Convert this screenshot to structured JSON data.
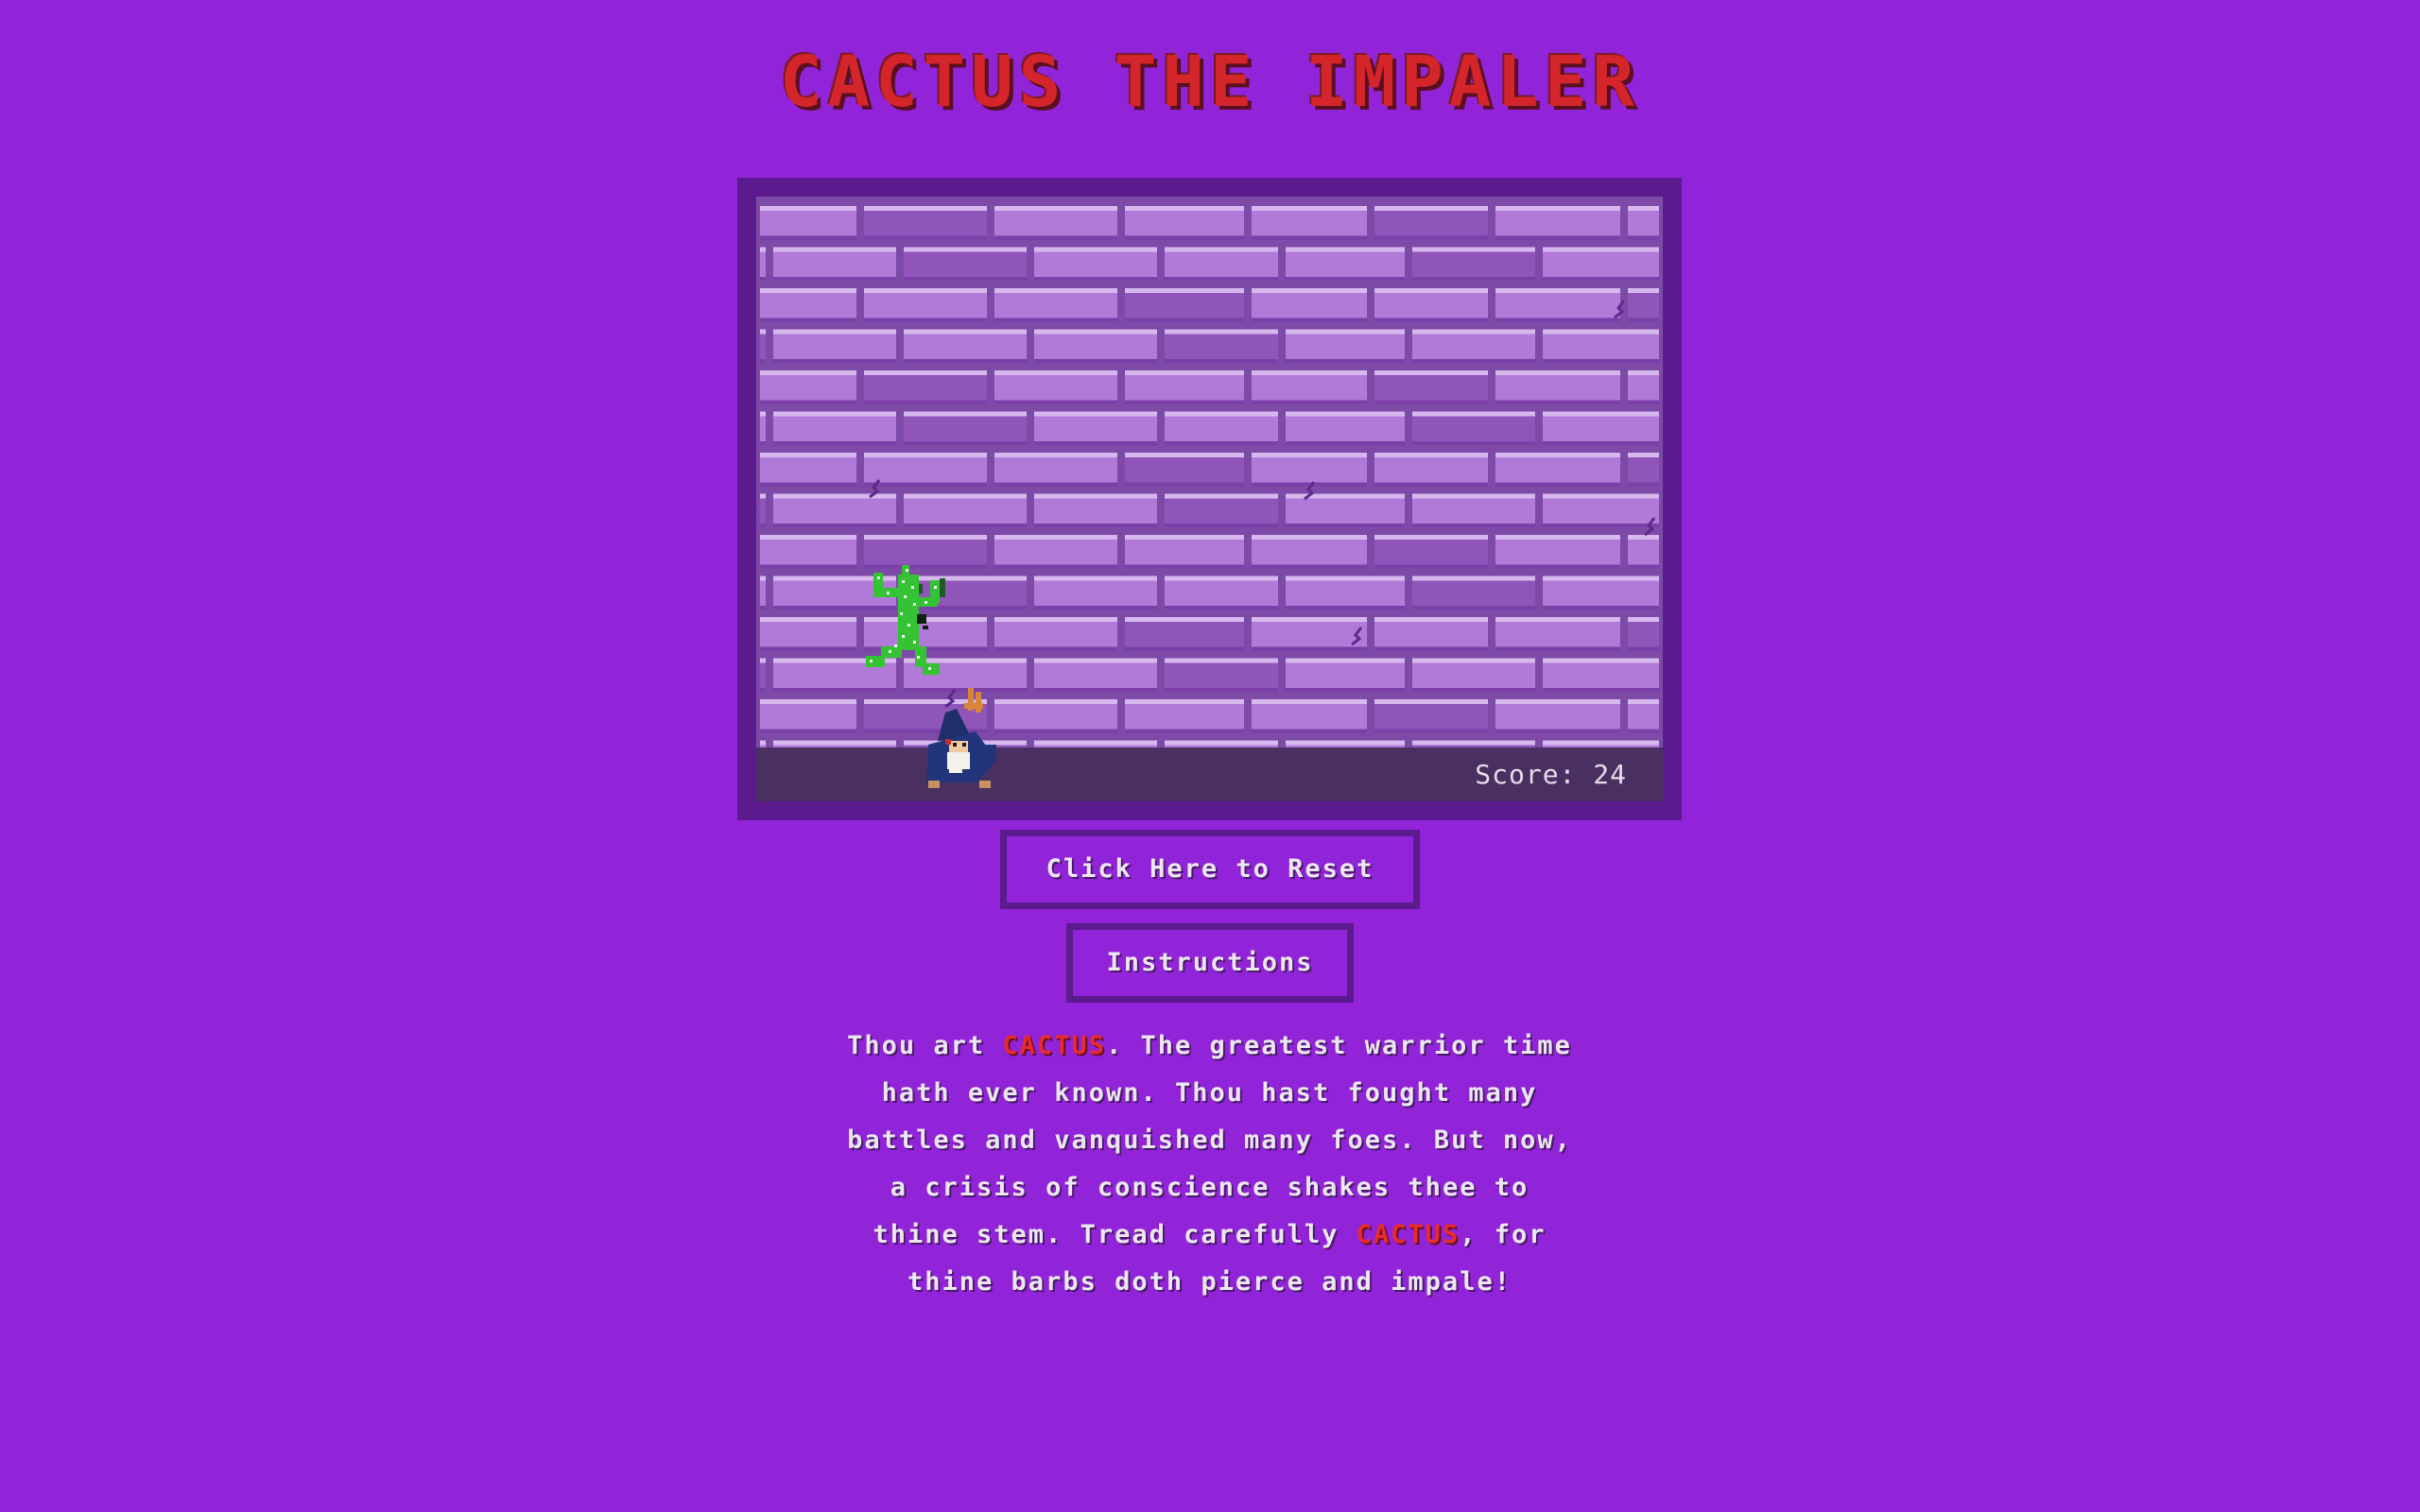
{
  "title": "CACTUS THE IMPALER",
  "game": {
    "score_label": "Score:",
    "score_value": "24"
  },
  "buttons": {
    "reset_label": "Click Here to Reset",
    "instructions_label": "Instructions"
  },
  "story": {
    "lines": [
      [
        "Thou art ",
        "CACTUS",
        ". The greatest warrior time"
      ],
      [
        "hath ever known. Thou hast fought many"
      ],
      [
        "battles and vanquished many foes. But now,"
      ],
      [
        "a crisis of conscience shakes thee to"
      ],
      [
        "thine stem. Tread carefully ",
        "CACTUS",
        ", for"
      ],
      [
        "thine barbs doth pierce and impale!"
      ]
    ]
  },
  "colors": {
    "background": "#9123d8",
    "frame": "#5b1a8e",
    "title_red": "#d4252a",
    "highlight_red": "#e82c2c",
    "brick_light": "#b27ad8",
    "brick_dark": "#8f55b8",
    "ground": "#4a3060",
    "cactus_green": "#3fd43a"
  },
  "icons": {
    "player": "cactus-sprite",
    "enemy": "wizard-sprite"
  }
}
